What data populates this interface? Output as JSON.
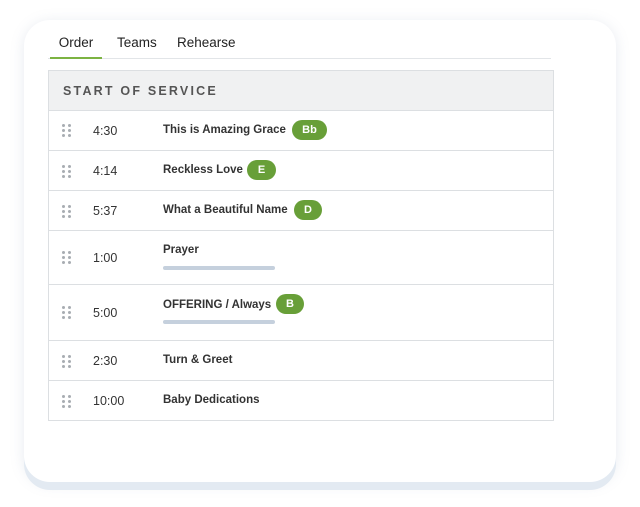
{
  "tabs": [
    {
      "label": "Order",
      "active": true
    },
    {
      "label": "Teams",
      "active": false
    },
    {
      "label": "Rehearse",
      "active": false
    }
  ],
  "section": {
    "title": "START OF SERVICE"
  },
  "items": [
    {
      "time": "4:30",
      "title": "This is Amazing Grace",
      "key": "Bb"
    },
    {
      "time": "4:14",
      "title": "Reckless Love",
      "key": "E"
    },
    {
      "time": "5:37",
      "title": "What a Beautiful Name",
      "key": "D"
    },
    {
      "time": "1:00",
      "title": "Prayer"
    },
    {
      "time": "5:00",
      "title": "OFFERING / Always",
      "key": "B"
    },
    {
      "time": "2:30",
      "title": "Turn & Greet"
    },
    {
      "time": "10:00",
      "title": "Baby Dedications"
    }
  ],
  "colors": {
    "accent": "#7cb342",
    "key_badge": "#689f38",
    "placeholder_bar": "#c5d0dd"
  },
  "icons": {
    "drag_handle": "drag-handle-icon"
  }
}
